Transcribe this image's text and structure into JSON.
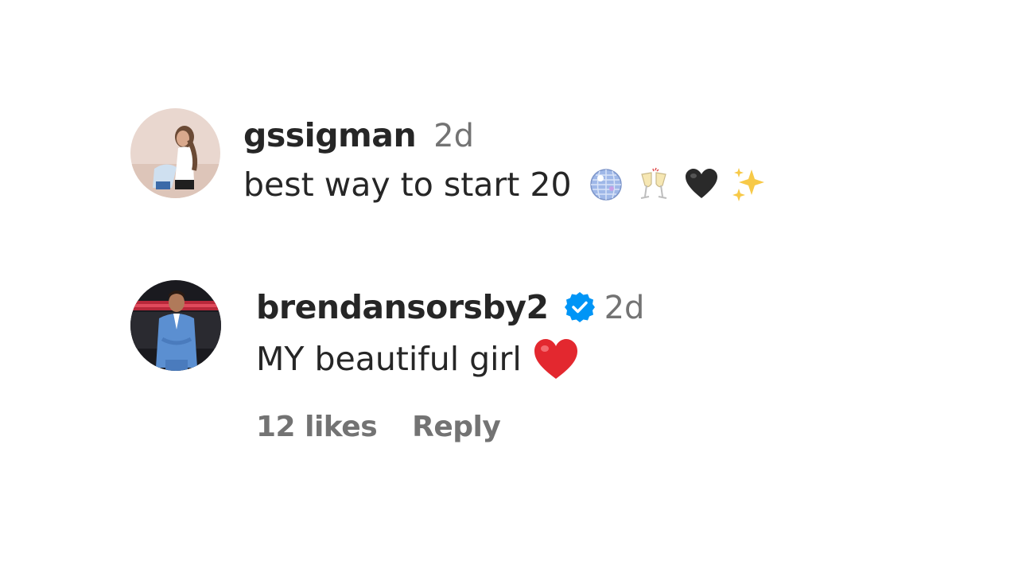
{
  "comments": [
    {
      "username": "gssigman",
      "time": "2d",
      "text": "best way to start 20",
      "verified": false,
      "emojis": [
        "disco-ball",
        "champagne-toast",
        "black-heart",
        "sparkles"
      ]
    },
    {
      "username": "brendansorsby2",
      "time": "2d",
      "text": "MY beautiful girl",
      "verified": true,
      "emojis": [
        "red-heart"
      ],
      "likes": "12 likes",
      "reply_label": "Reply"
    }
  ],
  "colors": {
    "text": "#262626",
    "secondary": "#737373",
    "verified_badge": "#0095F6"
  }
}
